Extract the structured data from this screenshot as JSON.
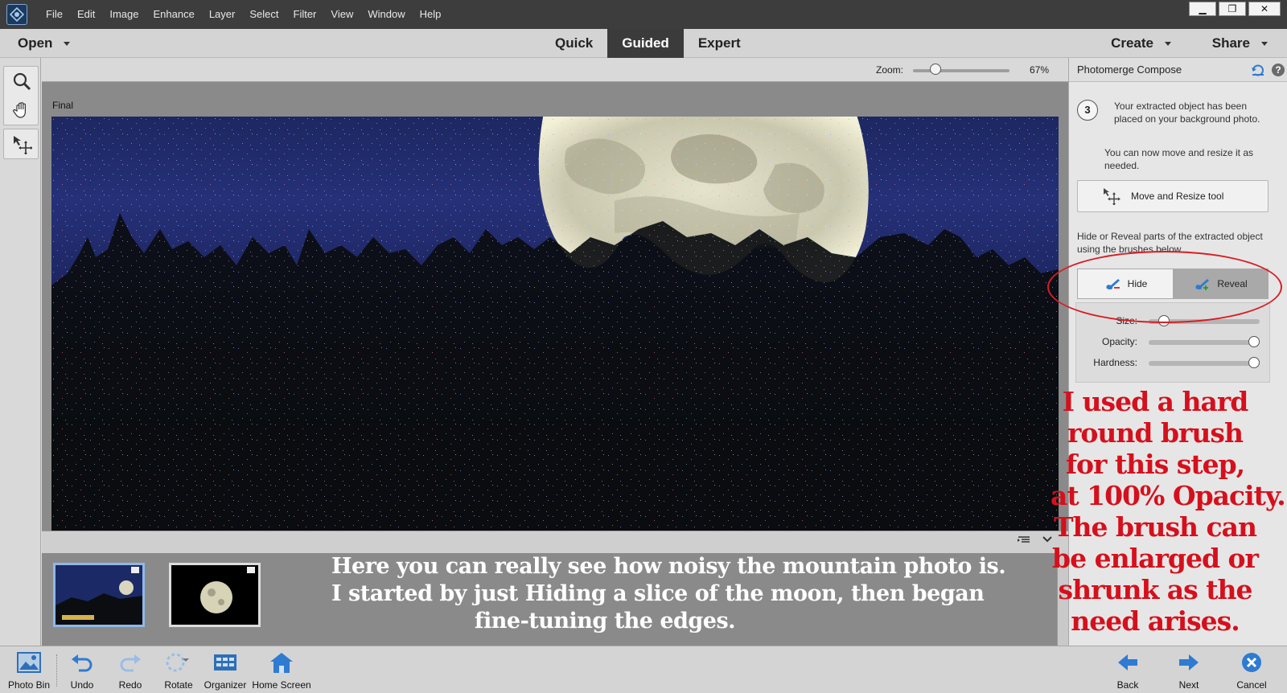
{
  "menu": {
    "items": [
      "File",
      "Edit",
      "Image",
      "Enhance",
      "Layer",
      "Select",
      "Filter",
      "View",
      "Window",
      "Help"
    ]
  },
  "window_controls": {
    "minimize": "▁",
    "restore": "❐",
    "close": "✕"
  },
  "modebar": {
    "open": "Open",
    "tabs": [
      "Quick",
      "Guided",
      "Expert"
    ],
    "active_tab": "Guided",
    "create": "Create",
    "share": "Share"
  },
  "toolbar": {
    "tools": [
      "zoom-icon",
      "hand-icon",
      "move-icon"
    ]
  },
  "canvas": {
    "zoom_label": "Zoom:",
    "zoom_value": "67%",
    "zoom_level": 0.2,
    "doc_label": "Final"
  },
  "photo_bin": {
    "annotation": [
      "Here you can really see how noisy the mountain photo is.",
      "I started by just Hiding a slice of the moon, then began",
      "fine-tuning the edges."
    ]
  },
  "panel": {
    "title": "Photomerge Compose",
    "step_number": "3",
    "step_text": "Your extracted object has been placed on your background photo.",
    "step_text2": "You can now move and resize it as needed.",
    "move_button": "Move and Resize tool",
    "hide_reveal_text": "Hide or Reveal parts of the extracted object using the brushes below.",
    "hide": "Hide",
    "reveal": "Reveal",
    "active_brush": "Reveal",
    "settings": [
      {
        "label": "Size:",
        "level": 0.1
      },
      {
        "label": "Opacity:",
        "level": 1.0
      },
      {
        "label": "Hardness:",
        "level": 1.0
      }
    ],
    "annotation": [
      "I used a hard",
      "round brush",
      "for this step,",
      "at 100% Opacity.",
      "The brush can",
      "be enlarged or",
      "shrunk as the",
      "need arises."
    ]
  },
  "bottombar": {
    "photo_bin": "Photo Bin",
    "undo": "Undo",
    "redo": "Redo",
    "rotate": "Rotate",
    "organizer": "Organizer",
    "home_screen": "Home Screen",
    "back": "Back",
    "next": "Next",
    "cancel": "Cancel"
  },
  "colors": {
    "accent_blue": "#2f7bd1",
    "annotation_red": "#d5101c",
    "active_tab": "#3b3b3b"
  }
}
